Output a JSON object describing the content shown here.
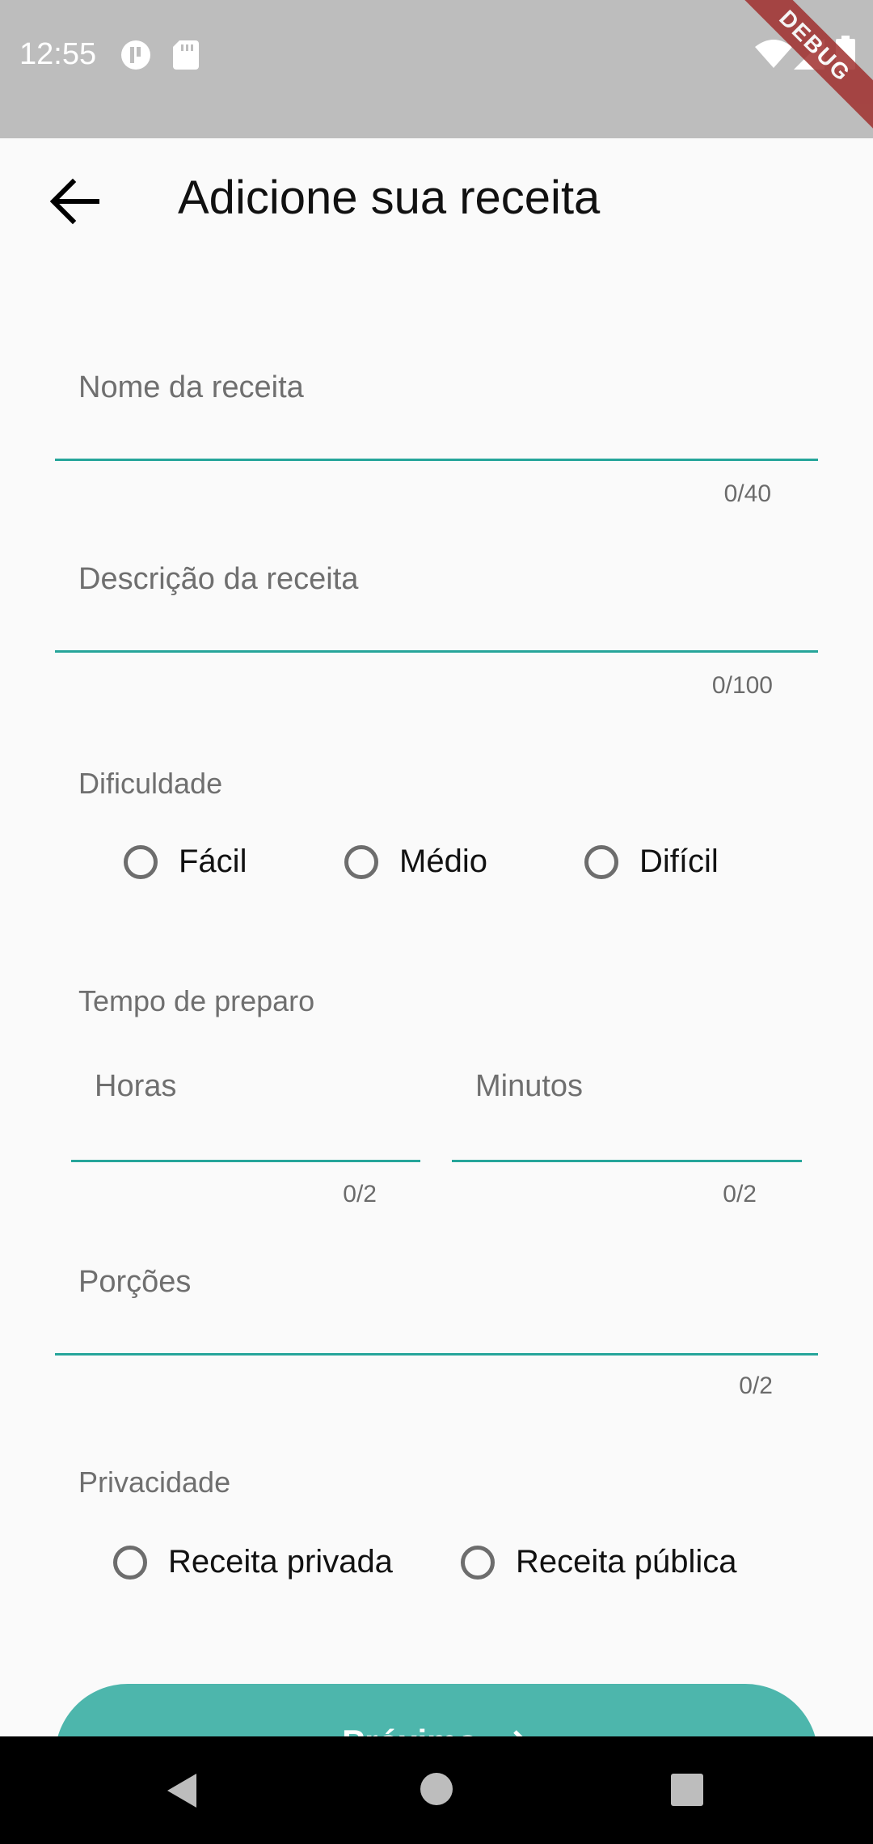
{
  "status_bar": {
    "time": "12:55",
    "icons": [
      "notification-icon",
      "sd-card-icon",
      "wifi-icon",
      "signal-icon",
      "battery-icon"
    ],
    "debug_banner": "DEBUG"
  },
  "app_bar": {
    "title": "Adicione sua receita",
    "back_icon": "arrow-back-icon"
  },
  "form": {
    "recipe_name": {
      "label": "Nome da receita",
      "counter": "0/40"
    },
    "recipe_description": {
      "label": "Descrição da receita",
      "counter": "0/100"
    },
    "difficulty": {
      "label": "Dificuldade",
      "options": [
        "Fácil",
        "Médio",
        "Difícil"
      ]
    },
    "prep_time": {
      "label": "Tempo de preparo",
      "hours": {
        "label": "Horas",
        "counter": "0/2"
      },
      "minutes": {
        "label": "Minutos",
        "counter": "0/2"
      }
    },
    "servings": {
      "label": "Porções",
      "counter": "0/2"
    },
    "privacy": {
      "label": "Privacidade",
      "options": [
        "Receita privada",
        "Receita pública"
      ]
    }
  },
  "next_button": {
    "label": "Próximo",
    "icon": "arrow-forward-icon"
  },
  "colors": {
    "accent": "#26a59a",
    "button": "#4db6ac",
    "status_bar": "#bdbdbd",
    "debug_banner": "#a0302e"
  }
}
